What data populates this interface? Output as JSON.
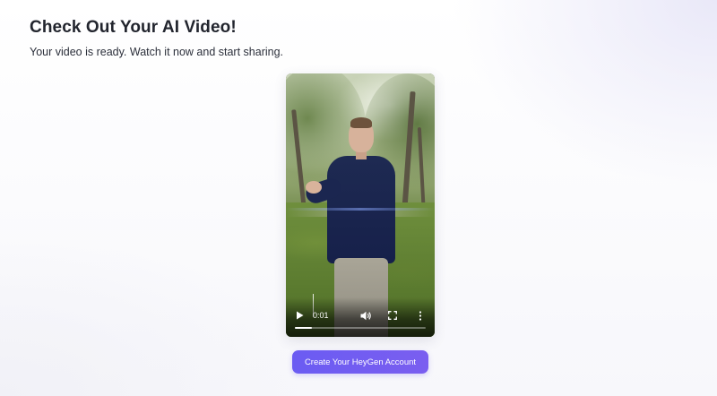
{
  "page": {
    "title": "Check Out Your AI Video!",
    "subtitle": "Your video is ready. Watch it now and start sharing."
  },
  "video": {
    "current_time": "0:01",
    "progress": 0.13,
    "controls": {
      "play_icon": "play-icon",
      "volume_icon": "volume-icon",
      "fullscreen_icon": "fullscreen-icon",
      "more_icon": "more-vertical-icon"
    }
  },
  "cta": {
    "label": "Create Your HeyGen Account"
  },
  "colors": {
    "accent": "#6b5cf2",
    "title_text": "#22252e"
  }
}
